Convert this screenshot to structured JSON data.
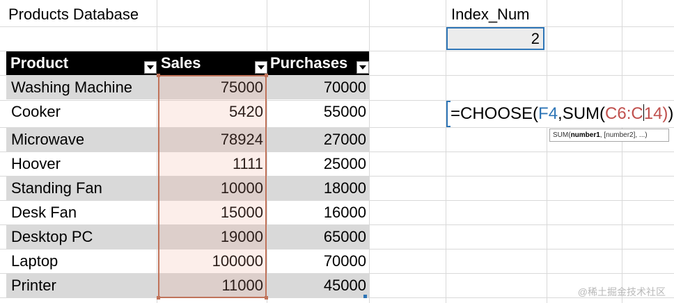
{
  "sheet": {
    "title": "Products Database",
    "index_label": "Index_Num",
    "index_value": "2"
  },
  "table": {
    "headers": [
      "Product",
      "Sales",
      "Purchases"
    ],
    "rows": [
      {
        "product": "Washing Machine",
        "sales": "75000",
        "purchases": "70000"
      },
      {
        "product": "Cooker",
        "sales": "5420",
        "purchases": "55000"
      },
      {
        "product": "Microwave",
        "sales": "78924",
        "purchases": "27000"
      },
      {
        "product": "Hoover",
        "sales": "1111",
        "purchases": "25000"
      },
      {
        "product": "Standing Fan",
        "sales": "10000",
        "purchases": "18000"
      },
      {
        "product": "Desk Fan",
        "sales": "15000",
        "purchases": "16000"
      },
      {
        "product": "Desktop PC",
        "sales": "19000",
        "purchases": "65000"
      },
      {
        "product": "Laptop",
        "sales": "100000",
        "purchases": "70000"
      },
      {
        "product": "Printer",
        "sales": "11000",
        "purchases": "45000"
      }
    ]
  },
  "formula": {
    "prefix": "=CHOOSE(",
    "ref1": "F4",
    "mid": ",SUM(",
    "range_a": "C6:C",
    "range_b": "14)",
    "suffix": ")"
  },
  "tooltip": {
    "fn": "SUM(",
    "arg1": "number1",
    "rest": ", [number2], ...)"
  },
  "watermark": "@稀土掘金技术社区",
  "colors": {
    "header_bg": "#000000",
    "row_shade": "#d9d9d9",
    "selection_blue": "#2e75b6",
    "range_red": "#c0735a"
  }
}
